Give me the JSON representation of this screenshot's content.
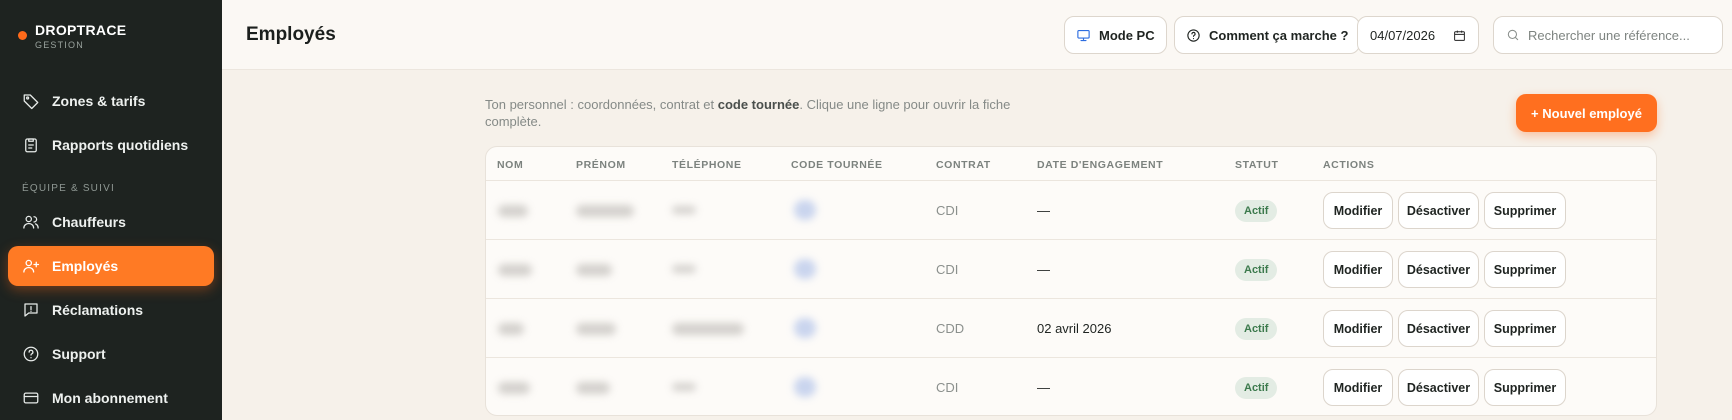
{
  "brand": {
    "name": "DROPTRACE",
    "sub": "GESTION",
    "accent": "#ff6a1a"
  },
  "sidebar": {
    "section_label": "ÉQUIPE & SUIVI",
    "items": [
      {
        "label": "Zones & tarifs",
        "icon": "tag-icon"
      },
      {
        "label": "Rapports quotidiens",
        "icon": "clipboard-icon"
      },
      {
        "label": "Chauffeurs",
        "icon": "users-icon"
      },
      {
        "label": "Employés",
        "icon": "user-plus-icon",
        "active": true
      },
      {
        "label": "Réclamations",
        "icon": "message-alert-icon"
      },
      {
        "label": "Support",
        "icon": "help-circle-icon"
      },
      {
        "label": "Mon abonnement",
        "icon": "credit-card-icon"
      }
    ]
  },
  "header": {
    "title": "Employés",
    "mode_pc": "Mode PC",
    "how_it_works": "Comment ça marche ?",
    "date": "04/07/2026",
    "search_placeholder": "Rechercher une référence..."
  },
  "main": {
    "intro_pre": "Ton personnel : coordonnées, contrat et ",
    "intro_bold": "code tournée",
    "intro_post": ". Clique une ligne pour ouvrir la fiche complète.",
    "new_button": "+ Nouvel employé"
  },
  "table": {
    "headers": [
      "NOM",
      "PRÉNOM",
      "TÉLÉPHONE",
      "CODE TOURNÉE",
      "CONTRAT",
      "DATE D'ENGAGEMENT",
      "STATUT",
      "ACTIONS"
    ],
    "rows": [
      {
        "contrat": "CDI",
        "date": "—",
        "statut": "Actif"
      },
      {
        "contrat": "CDI",
        "date": "—",
        "statut": "Actif"
      },
      {
        "contrat": "CDD",
        "date": "02 avril 2026",
        "statut": "Actif"
      },
      {
        "contrat": "CDI",
        "date": "—",
        "statut": "Actif"
      }
    ],
    "actions": {
      "edit": "Modifier",
      "deactivate": "Désactiver",
      "delete": "Supprimer"
    }
  },
  "colors": {
    "sidebar_bg": "#1e2320",
    "active_nav": "#ff7a24",
    "status_active_text": "#3c7a4d",
    "status_active_bg": "#e3ece4"
  }
}
